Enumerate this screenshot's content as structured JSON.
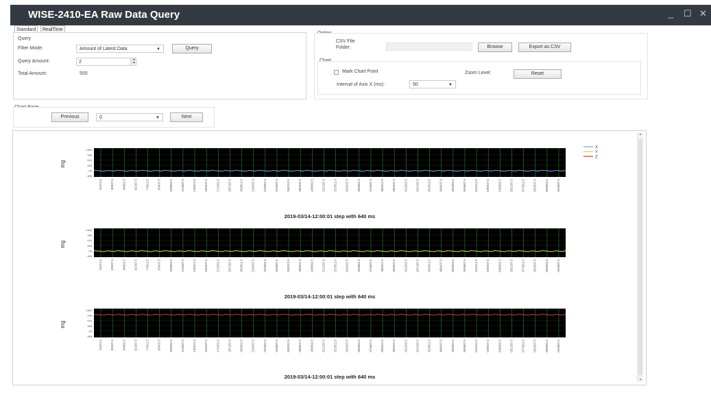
{
  "window": {
    "title": "WISE-2410-EA Raw Data Query",
    "minimize": "_",
    "maximize": "☐",
    "close": "✕"
  },
  "tabs": [
    {
      "label": "Standard",
      "active": true
    },
    {
      "label": "RealTime",
      "active": false
    }
  ],
  "query": {
    "group_label": "Query",
    "filter_mode_label": "Filter Mode:",
    "filter_mode_value": "Amount of Latest Data",
    "query_button": "Query",
    "amount_label": "Query Amount:",
    "amount_value": "2",
    "total_label": "Total Amount:",
    "total_value": "500"
  },
  "option": {
    "group_label": "Option",
    "csv_label_1": "CSV File",
    "csv_label_2": "Folder:",
    "csv_value": "",
    "browse_button": "Browse",
    "export_button": "Export as CSV",
    "chart_group_label": "Chart",
    "mark_point_label": "Mark Chart Point",
    "mark_point_checked": false,
    "zoom_label": "Zoom Level:",
    "reset_button": "Reset",
    "interval_label": "Interval of Axis X (ms):",
    "interval_value": "50"
  },
  "chart_page": {
    "label": "Chart Page",
    "previous_button": "Previous",
    "page_value": "0",
    "next_button": "Next"
  },
  "colors": {
    "x_series": "#6fa3d8",
    "y_series": "#d9c86a",
    "z_series": "#c0392b",
    "plot_bg": "#000000",
    "titlebar": "#343a41"
  },
  "chart_data": [
    {
      "type": "line",
      "ylabel": "mg",
      "y_ticks": [
        "1365",
        "946",
        "615",
        "285",
        "-35",
        "-385"
      ],
      "ylim": [
        -385,
        1365
      ],
      "x_ticks": [
        "15312.5",
        "30937.5",
        "46562.5",
        "62187.5",
        "77812.5",
        "93437.5",
        "109062.5",
        "124687.5",
        "140312.5",
        "155937.5",
        "171562.5",
        "187187.5",
        "202812.5",
        "218437.5",
        "234062.5",
        "249687.5",
        "265312.5",
        "280937.5",
        "296562.5",
        "312187.5",
        "327812.5",
        "343437.5",
        "359062.5",
        "374687.5",
        "390312.5",
        "405937.5",
        "421562.5",
        "437187.5",
        "452812.5",
        "468437.5",
        "484062.5",
        "499687.5",
        "515312.5",
        "530937.5",
        "546562.5",
        "562187.5",
        "577812.5",
        "593437.5",
        "609062.5",
        "624687.5"
      ],
      "xlabel": "2019-03/14-12:00:01 step with 640 ms",
      "legend": [
        "X",
        "Y",
        "Z"
      ],
      "legend_position": "top-right",
      "series": [
        {
          "name": "X",
          "level": -10
        }
      ]
    },
    {
      "type": "line",
      "ylabel": "mg",
      "y_ticks": [
        "1365",
        "946",
        "615",
        "285",
        "-35",
        "-385"
      ],
      "ylim": [
        -385,
        1365
      ],
      "x_ticks": [
        "15312.5",
        "30937.5",
        "46562.5",
        "62187.5",
        "77812.5",
        "93437.5",
        "109062.5",
        "124687.5",
        "140312.5",
        "155937.5",
        "171562.5",
        "187187.5",
        "202812.5",
        "218437.5",
        "234062.5",
        "249687.5",
        "265312.5",
        "280937.5",
        "296562.5",
        "312187.5",
        "327812.5",
        "343437.5",
        "359062.5",
        "374687.5",
        "390312.5",
        "405937.5",
        "421562.5",
        "437187.5",
        "452812.5",
        "468437.5",
        "484062.5",
        "499687.5",
        "515312.5",
        "530937.5",
        "546562.5",
        "562187.5",
        "577812.5",
        "593437.5",
        "609062.5",
        "624687.5"
      ],
      "xlabel": "2019-03/14-12:00:01 step with 640 ms",
      "series": [
        {
          "name": "Y",
          "level": -20
        }
      ]
    },
    {
      "type": "line",
      "ylabel": "mg",
      "y_ticks": [
        "1365",
        "946",
        "615",
        "285",
        "-35",
        "-385"
      ],
      "ylim": [
        -385,
        1365
      ],
      "x_ticks": [
        "15312.5",
        "30937.5",
        "46562.5",
        "62187.5",
        "77812.5",
        "93437.5",
        "109062.5",
        "124687.5",
        "140312.5",
        "155937.5",
        "171562.5",
        "187187.5",
        "202812.5",
        "218437.5",
        "234062.5",
        "249687.5",
        "265312.5",
        "280937.5",
        "296562.5",
        "312187.5",
        "327812.5",
        "343437.5",
        "359062.5",
        "374687.5",
        "390312.5",
        "405937.5",
        "421562.5",
        "437187.5",
        "452812.5",
        "468437.5",
        "484062.5",
        "499687.5",
        "515312.5",
        "530937.5",
        "546562.5",
        "562187.5",
        "577812.5",
        "593437.5",
        "609062.5",
        "624687.5"
      ],
      "xlabel": "2019-03/14-12:00:01 step with 640 ms",
      "series": [
        {
          "name": "Z",
          "level": 1000
        }
      ]
    }
  ]
}
